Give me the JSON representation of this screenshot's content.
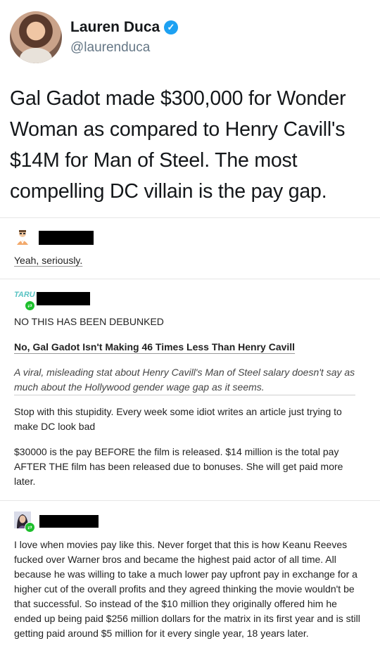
{
  "tweet": {
    "display_name": "Lauren Duca",
    "handle": "@laurenduca",
    "verified_glyph": "✓",
    "text": "Gal Gadot made $300,000 for Wonder Woman as compared to Henry Cavill's $14M for Man of Steel. The most compelling DC villain is the pay gap."
  },
  "replies": [
    {
      "avatar_icon": "cartoon-person-avatar-icon",
      "text": "Yeah, seriously."
    },
    {
      "avatar_icon": "blog-logo-avatar-icon",
      "avatar_text": "TARU",
      "badge_icon": "reblog-icon",
      "intro": "NO THIS HAS BEEN DEBUNKED",
      "link_title": "No, Gal Gadot Isn't Making 46 Times Less Than Henry Cavill",
      "link_description": "A viral, misleading stat about Henry Cavill's Man of Steel salary doesn't say as much about the Hollywood gender wage gap as it seems.",
      "para1": "Stop with this stupidity. Every week some idiot writes an article just trying to make DC look bad",
      "para2": "$30000 is the pay BEFORE the film is released. $14 million is the total pay AFTER THE film has been released due to bonuses. She will get paid more later."
    },
    {
      "avatar_icon": "dark-hair-avatar-icon",
      "badge_icon": "reblog-icon",
      "text": "I love when movies pay like this. Never forget that this is how Keanu Reeves fucked over Warner bros and became the highest paid actor of all time. All because he was willing to take a much lower pay upfront pay in exchange for a higher cut of the overall profits and they agreed thinking the movie wouldn't be that successful. So instead of the $10 million they originally offered him he ended up being paid $256 million dollars for the matrix in its first year and is still getting paid around $5 million for it every single year, 18 years later."
    }
  ],
  "colors": {
    "verified": "#1da1f2",
    "reblog_badge": "#1dbf2c",
    "handle": "#657786",
    "divider": "#e6e6e6"
  }
}
